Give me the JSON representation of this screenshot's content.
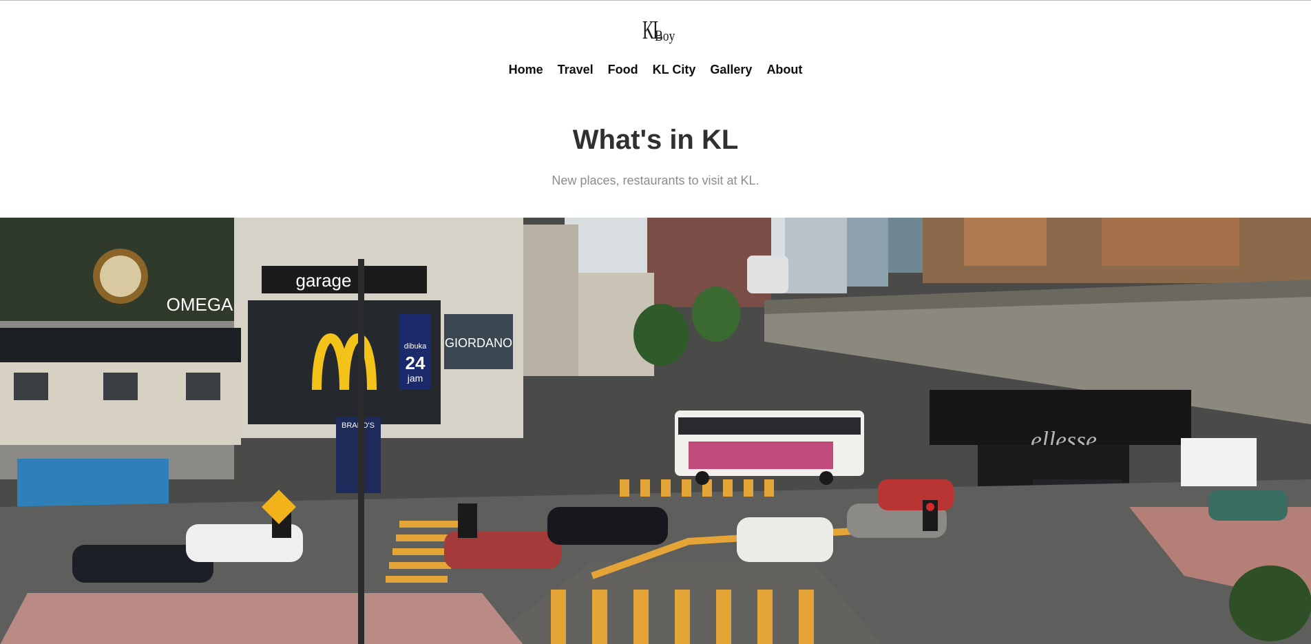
{
  "header": {
    "logo_main": "KL",
    "logo_sub": "Boy"
  },
  "nav": {
    "items": [
      "Home",
      "Travel",
      "Food",
      "KL City",
      "Gallery",
      "About"
    ]
  },
  "hero": {
    "title": "What's in KL",
    "subtitle": "New places, restaurants to visit at KL."
  },
  "photo": {
    "signs": {
      "omega": "OMEGA",
      "giordano": "GIORDANO",
      "ellesse": "ellesse",
      "mcd_24": "24",
      "mcd_dibuka": "dibuka",
      "mcd_jam": "jam",
      "garage": "garage",
      "brands": "BRAND'S"
    }
  }
}
